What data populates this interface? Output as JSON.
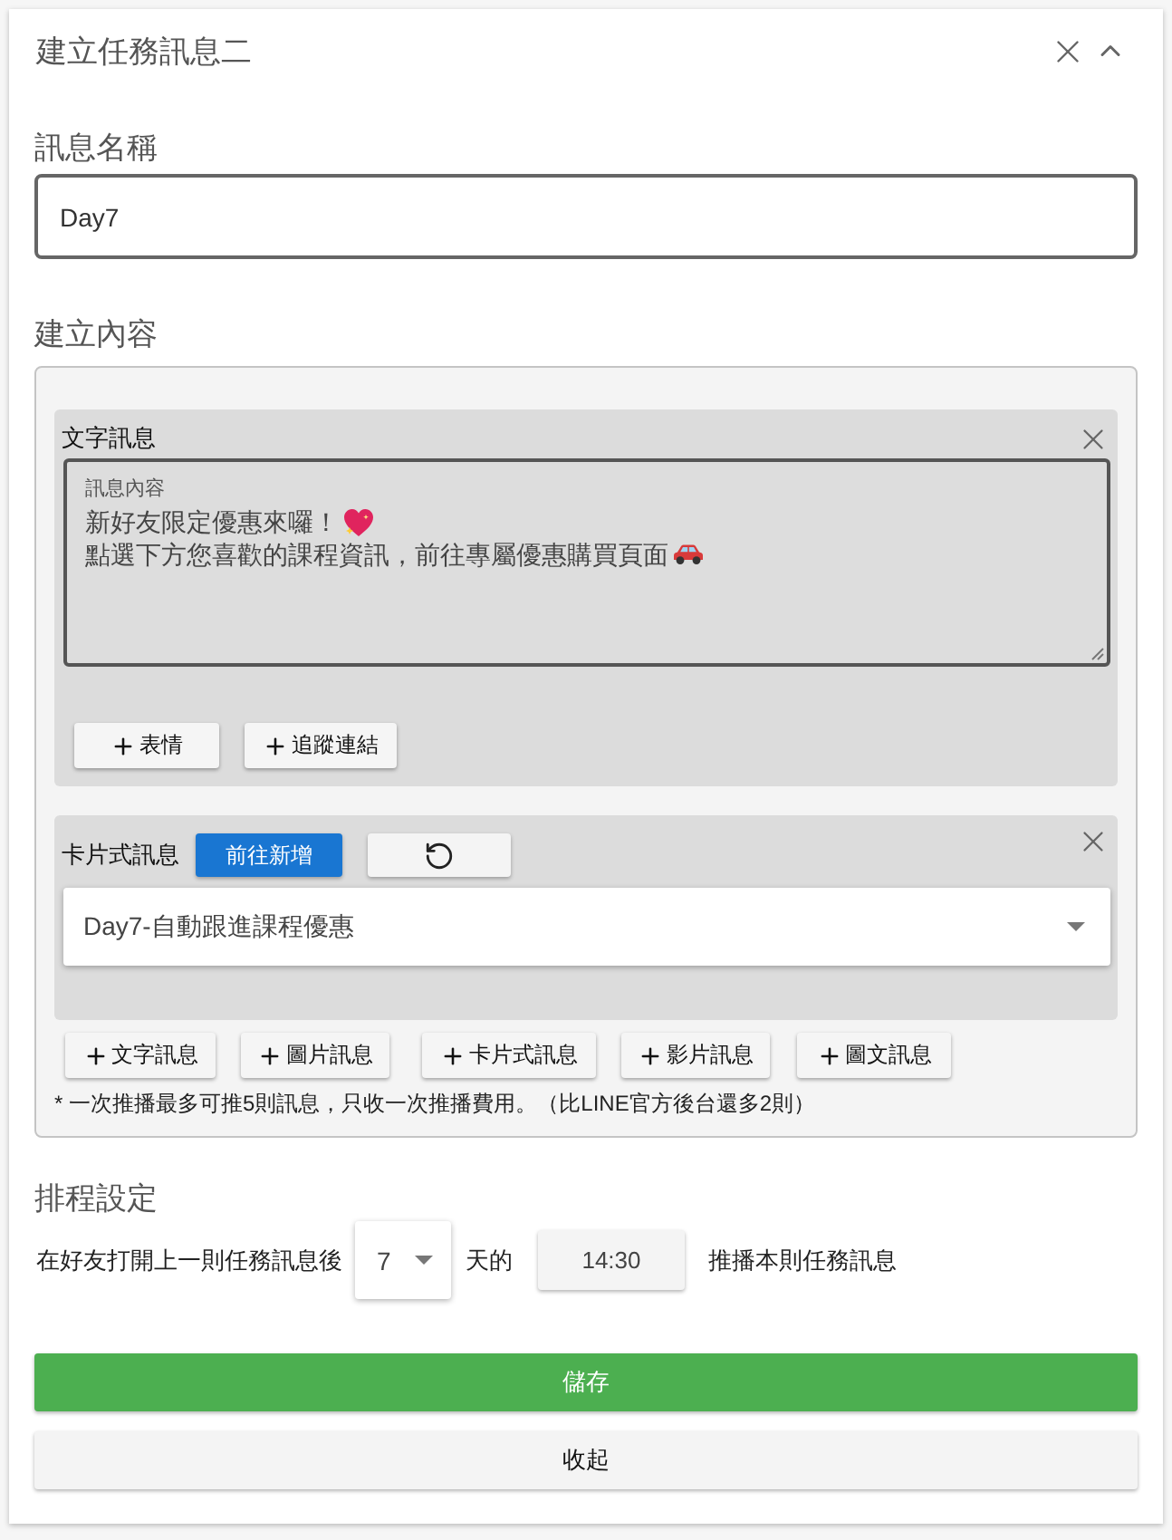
{
  "panel": {
    "title": "建立任務訊息二",
    "expanded": true
  },
  "name_field": {
    "label": "訊息名稱",
    "value": "Day7"
  },
  "content": {
    "label": "建立內容",
    "blocks": [
      {
        "kind": "text",
        "title": "文字訊息",
        "field_label": "訊息內容",
        "lines": [
          "新好友限定優惠來囉！",
          "點選下方您喜歡的課程資訊，前往專屬優惠購買頁面"
        ],
        "buttons": [
          "表情",
          "追蹤連結"
        ]
      },
      {
        "kind": "card",
        "title": "卡片式訊息",
        "action": "前往新增",
        "select_value": "Day7-自動跟進課程優惠"
      }
    ],
    "add_buttons": [
      "文字訊息",
      "圖片訊息",
      "卡片式訊息",
      "影片訊息",
      "圖文訊息"
    ],
    "note": "* 一次推播最多可推5則訊息，只收一次推播費用。（比LINE官方後台還多2則）"
  },
  "schedule": {
    "label": "排程設定",
    "prefix": "在好友打開上一則任務訊息後",
    "days": "7",
    "middle": "天的",
    "time": "14:30",
    "suffix": "推播本則任務訊息"
  },
  "actions": {
    "save": "儲存",
    "collapse": "收起"
  }
}
